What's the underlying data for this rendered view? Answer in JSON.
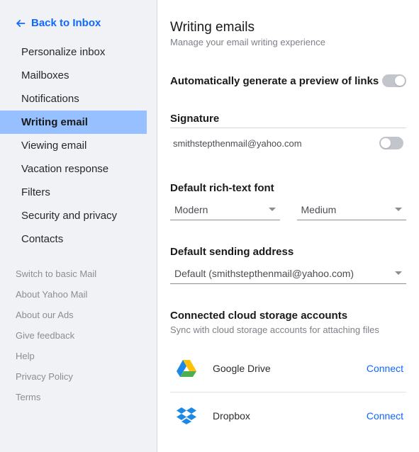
{
  "back_link": "Back to Inbox",
  "sidebar": {
    "items": [
      "Personalize inbox",
      "Mailboxes",
      "Notifications",
      "Writing email",
      "Viewing email",
      "Vacation response",
      "Filters",
      "Security and privacy",
      "Contacts"
    ],
    "active_index": 3,
    "sub_items": [
      "Switch to basic Mail",
      "About Yahoo Mail",
      "About our Ads",
      "Give feedback",
      "Help",
      "Privacy Policy",
      "Terms"
    ]
  },
  "page": {
    "title": "Writing emails",
    "subtitle": "Manage your email writing experience"
  },
  "preview_links": {
    "label": "Automatically generate a preview of links",
    "enabled": true
  },
  "signature": {
    "title": "Signature",
    "email": "smithstepthenmail@yahoo.com",
    "enabled": false
  },
  "font": {
    "title": "Default rich-text font",
    "family": "Modern",
    "size": "Medium"
  },
  "sending": {
    "title": "Default sending address",
    "value": "Default (smithstepthenmail@yahoo.com)"
  },
  "cloud": {
    "title": "Connected cloud storage accounts",
    "subtitle": "Sync with cloud storage accounts for attaching files",
    "items": [
      {
        "name": "Google Drive",
        "action": "Connect",
        "icon": "google-drive"
      },
      {
        "name": "Dropbox",
        "action": "Connect",
        "icon": "dropbox"
      }
    ]
  }
}
